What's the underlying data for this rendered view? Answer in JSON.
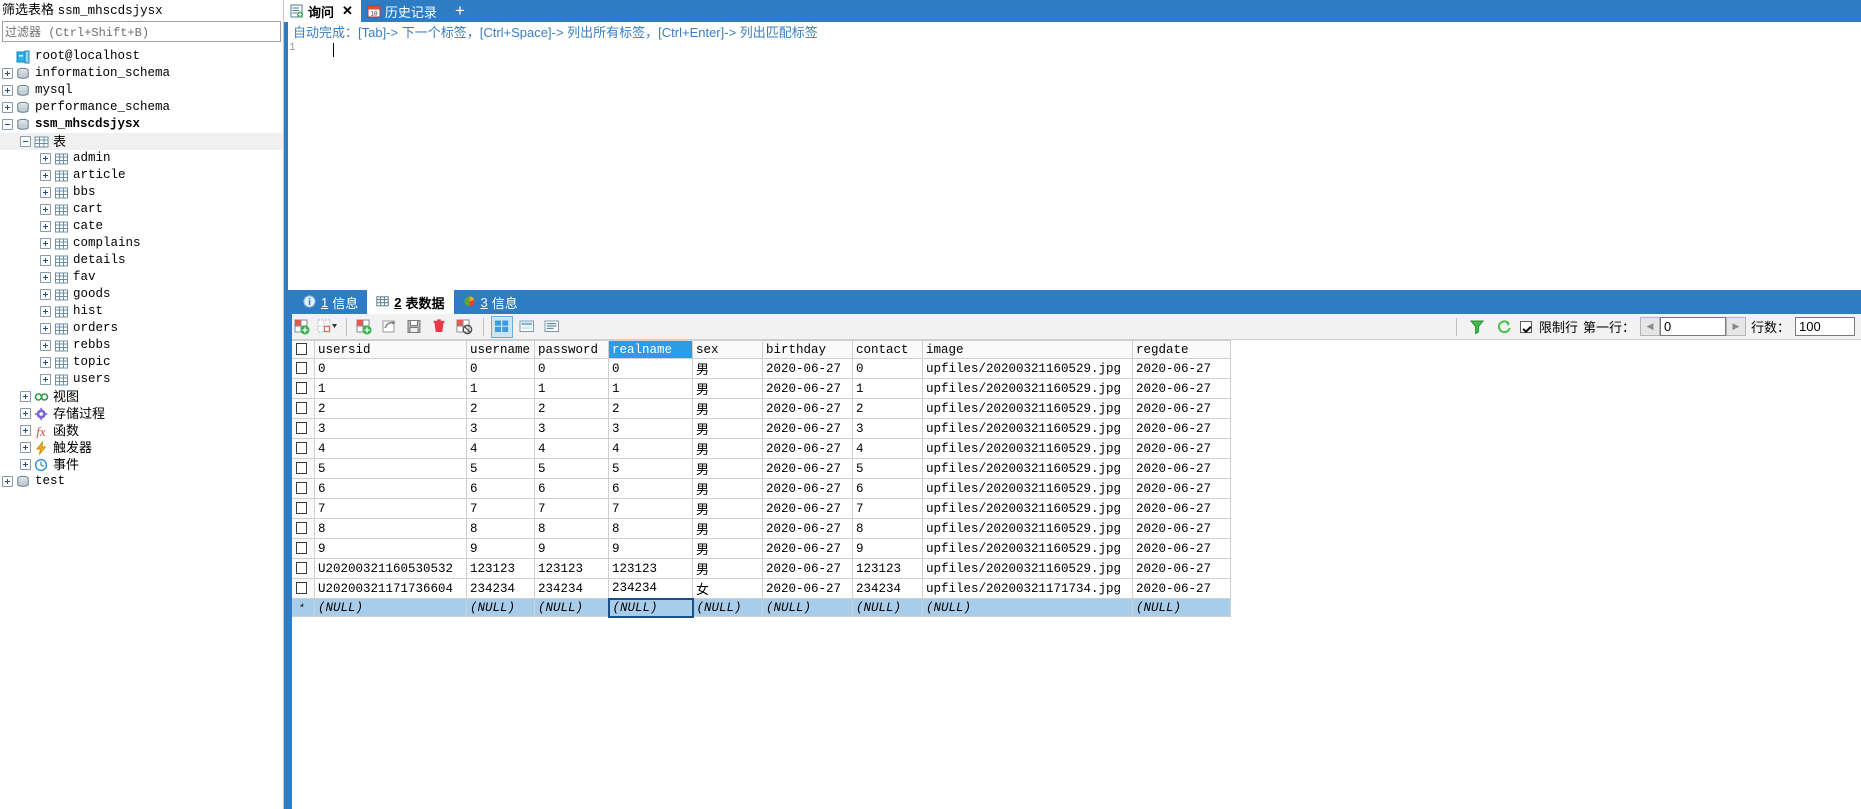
{
  "sidebar": {
    "title_prefix": "筛选表格",
    "title_db": "ssm_mhscdsjysx",
    "filter_placeholder": "过滤器 (Ctrl+Shift+B)",
    "root": "root@localhost",
    "databases": [
      {
        "label": "information_schema",
        "icon": "database-icon"
      },
      {
        "label": "mysql",
        "icon": "database-icon"
      },
      {
        "label": "performance_schema",
        "icon": "database-icon"
      },
      {
        "label": "ssm_mhscdsjysx",
        "icon": "database-icon"
      }
    ],
    "tables_group": "表",
    "tables": [
      "admin",
      "article",
      "bbs",
      "cart",
      "cate",
      "complains",
      "details",
      "fav",
      "goods",
      "hist",
      "orders",
      "rebbs",
      "topic",
      "users"
    ],
    "object_groups": [
      {
        "label": "视图",
        "icon": "view-icon"
      },
      {
        "label": "存储过程",
        "icon": "procedure-icon"
      },
      {
        "label": "函数",
        "icon": "function-icon"
      },
      {
        "label": "触发器",
        "icon": "trigger-icon"
      },
      {
        "label": "事件",
        "icon": "event-icon"
      }
    ],
    "last_database": "test"
  },
  "editor": {
    "tabs": [
      {
        "label": "询问",
        "icon": "query-icon",
        "active": true,
        "closable": true
      },
      {
        "label": "历史记录",
        "icon": "calendar-icon",
        "active": false,
        "closable": false
      }
    ],
    "add_tab_label": "+",
    "hint": "自动完成：[Tab]-> 下一个标签，[Ctrl+Space]-> 列出所有标签，[Ctrl+Enter]-> 列出匹配标签",
    "line_number": "1",
    "content": ""
  },
  "results": {
    "tabs": [
      {
        "num": "1",
        "label": "信息",
        "icon": "info-icon",
        "active": false
      },
      {
        "num": "2",
        "label": "表数据",
        "icon": "grid-icon",
        "active": true
      },
      {
        "num": "3",
        "label": "信息",
        "icon": "chart-icon",
        "active": false
      }
    ],
    "toolbar": {
      "buttons": [
        {
          "name": "insert-record-icon",
          "title": "插入记录"
        },
        {
          "name": "duplicate-record-icon",
          "title": "复制记录"
        },
        {
          "name": "post-record-icon",
          "title": "提交记录"
        },
        {
          "name": "revert-record-icon",
          "title": "撤销记录"
        },
        {
          "name": "save-icon",
          "title": "保存"
        },
        {
          "name": "delete-record-icon",
          "title": "删除记录"
        },
        {
          "name": "cancel-edit-icon",
          "title": "取消编辑"
        },
        {
          "name": "grid-view-icon",
          "title": "网格视图"
        },
        {
          "name": "form-view-icon",
          "title": "表单视图"
        },
        {
          "name": "text-view-icon",
          "title": "文本视图"
        }
      ],
      "filter_icon": "filter-icon",
      "refresh_icon": "refresh-icon",
      "limit_label": "限制行",
      "limit_checked": true,
      "first_row_label": "第一行：",
      "first_row_value": "0",
      "rows_label": "行数：",
      "rows_value": "100"
    },
    "columns": [
      "usersid",
      "username",
      "password",
      "realname",
      "sex",
      "birthday",
      "contact",
      "image",
      "regdate"
    ],
    "highlighted_column": "realname",
    "rows": [
      [
        "0",
        "0",
        "0",
        "0",
        "男",
        "2020-06-27",
        "0",
        "upfiles/20200321160529.jpg",
        "2020-06-27"
      ],
      [
        "1",
        "1",
        "1",
        "1",
        "男",
        "2020-06-27",
        "1",
        "upfiles/20200321160529.jpg",
        "2020-06-27"
      ],
      [
        "2",
        "2",
        "2",
        "2",
        "男",
        "2020-06-27",
        "2",
        "upfiles/20200321160529.jpg",
        "2020-06-27"
      ],
      [
        "3",
        "3",
        "3",
        "3",
        "男",
        "2020-06-27",
        "3",
        "upfiles/20200321160529.jpg",
        "2020-06-27"
      ],
      [
        "4",
        "4",
        "4",
        "4",
        "男",
        "2020-06-27",
        "4",
        "upfiles/20200321160529.jpg",
        "2020-06-27"
      ],
      [
        "5",
        "5",
        "5",
        "5",
        "男",
        "2020-06-27",
        "5",
        "upfiles/20200321160529.jpg",
        "2020-06-27"
      ],
      [
        "6",
        "6",
        "6",
        "6",
        "男",
        "2020-06-27",
        "6",
        "upfiles/20200321160529.jpg",
        "2020-06-27"
      ],
      [
        "7",
        "7",
        "7",
        "7",
        "男",
        "2020-06-27",
        "7",
        "upfiles/20200321160529.jpg",
        "2020-06-27"
      ],
      [
        "8",
        "8",
        "8",
        "8",
        "男",
        "2020-06-27",
        "8",
        "upfiles/20200321160529.jpg",
        "2020-06-27"
      ],
      [
        "9",
        "9",
        "9",
        "9",
        "男",
        "2020-06-27",
        "9",
        "upfiles/20200321160529.jpg",
        "2020-06-27"
      ],
      [
        "U20200321160530532",
        "123123",
        "123123",
        "123123",
        "男",
        "2020-06-27",
        "123123",
        "upfiles/20200321160529.jpg",
        "2020-06-27"
      ],
      [
        "U20200321171736604",
        "234234",
        "234234",
        "234234",
        "女",
        "2020-06-27",
        "234234",
        "upfiles/20200321171734.jpg",
        "2020-06-27"
      ]
    ],
    "new_row": [
      "(NULL)",
      "(NULL)",
      "(NULL)",
      "(NULL)",
      "(NULL)",
      "(NULL)",
      "(NULL)",
      "(NULL)",
      "(NULL)"
    ],
    "new_row_marker": "*"
  },
  "colors": {
    "accent": "#2e7cc3",
    "header_highlight": "#2e9be6",
    "selected_row": "#a8cdeb",
    "hint_text": "#3a7ec0"
  }
}
